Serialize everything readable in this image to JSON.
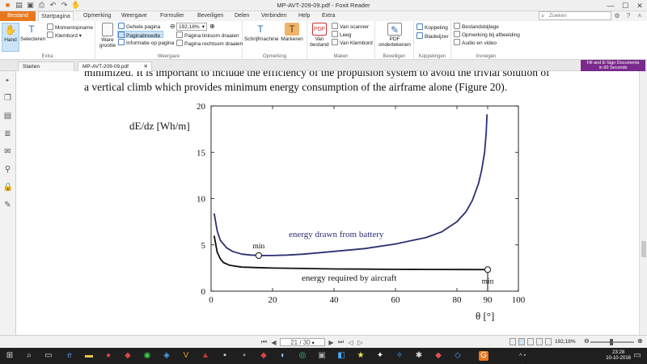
{
  "window": {
    "title": "MP-AVT-209-09.pdf - Foxit Reader"
  },
  "ribbon_tabs": [
    "Bestand",
    "Startpagina",
    "Opmerking",
    "Weergave",
    "Formulier",
    "Beveiligen",
    "Delen",
    "Verbinden",
    "Help",
    "Extra"
  ],
  "search": {
    "placeholder": "Zoeken"
  },
  "ribbon": {
    "hand": "Hand",
    "selecteren": "Selecteren",
    "momentopname": "Momentopname",
    "klembord": "Klembord",
    "group_extra": "Extra",
    "ware_grootte": "Ware grootte",
    "gehele_pagina": "Gehele pagina",
    "paginabreedte": "Paginabreedte",
    "informatie_op_pagina": "Informatie op pagina",
    "zoom_value": "192,18%",
    "linksom": "Pagina linksom draaien",
    "rechtsom": "Pagina rechtsom draaien",
    "group_weergave": "Weergave",
    "schrijfmachine": "Schrijfmachine",
    "markeren": "Markeren",
    "group_opmerking": "Opmerking",
    "van_bestand": "Van bestand",
    "van_scanner": "Van scanner",
    "leeg": "Leeg",
    "van_klembord": "Van Klembord",
    "group_maken": "Maken",
    "pdf_ondertekenen": "PDF ondertekenen",
    "group_beveiligen": "Beveiligen",
    "koppeling": "Koppeling",
    "bladwijzer": "Bladwijzer",
    "group_koppelingen": "Koppelingen",
    "bestandsbijlage": "Bestandsbijlage",
    "opmerking_bij_afbeelding": "Opmerking bij afbeelding",
    "audio_en_video": "Audio en video",
    "group_invoegen": "Invoegen"
  },
  "doc_tabs": [
    "Starten",
    "MP-AVT-209-09.pdf"
  ],
  "banner": {
    "line1": "Fill and E-Sign Documents",
    "line2": "in 60 Seconds"
  },
  "document": {
    "line1": "minimized. It is important to include the efficiency of the propulsion system to avoid the trivial solution of",
    "line2": "a vertical climb which provides minimum energy consumption of the airframe alone (Figure 20)."
  },
  "chart_data": {
    "type": "line",
    "ylabel": "dE/dz [Wh/m]",
    "xlabel": "θ [°]",
    "xlim": [
      0,
      100
    ],
    "ylim": [
      0,
      20
    ],
    "xticks": [
      0,
      20,
      40,
      60,
      80,
      90,
      100
    ],
    "yticks": [
      0,
      5,
      10,
      15,
      20
    ],
    "grid": false,
    "series": [
      {
        "name": "energy drawn from battery",
        "color": "#2b2f73",
        "x": [
          1,
          2,
          3,
          5,
          7,
          10,
          13,
          16,
          20,
          25,
          30,
          40,
          50,
          60,
          70,
          75,
          80,
          83,
          85,
          87,
          88,
          89,
          89.5,
          89.8
        ],
        "y": [
          8.4,
          6.5,
          5.5,
          4.7,
          4.3,
          4.0,
          3.9,
          3.85,
          3.85,
          3.9,
          4.0,
          4.3,
          4.6,
          5.1,
          5.8,
          6.4,
          7.5,
          8.6,
          9.8,
          11.6,
          13.0,
          15.0,
          17.0,
          19.1
        ]
      },
      {
        "name": "energy required by aircraft",
        "color": "#111111",
        "x": [
          1,
          2,
          3,
          4,
          6,
          8,
          10,
          15,
          20,
          30,
          40,
          50,
          60,
          70,
          80,
          90
        ],
        "y": [
          6.0,
          4.2,
          3.5,
          3.1,
          2.8,
          2.7,
          2.6,
          2.55,
          2.5,
          2.45,
          2.4,
          2.38,
          2.36,
          2.35,
          2.34,
          2.33
        ]
      }
    ],
    "annotations": [
      {
        "text": "min",
        "x": 15.5,
        "y": 3.85
      },
      {
        "text": "min",
        "x": 90,
        "y": 2.33
      }
    ]
  },
  "statusbar": {
    "page": "21 / 30",
    "zoom": "192,18%"
  },
  "taskbar": {
    "time": "23:28",
    "date": "10-10-2016"
  }
}
